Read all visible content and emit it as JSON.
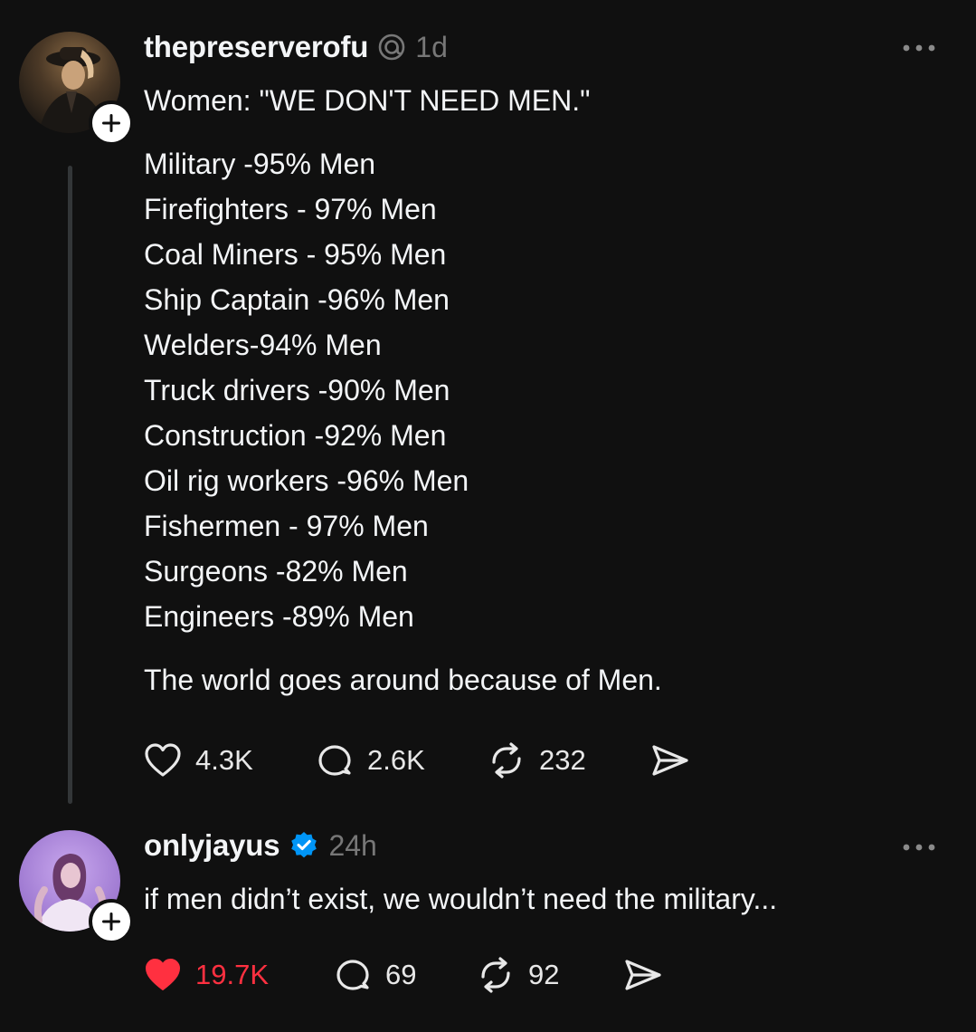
{
  "posts": [
    {
      "username": "thepreserverofu",
      "time": "1d",
      "lines": [
        "Women: \"WE DON'T NEED MEN.\"",
        "Military -95% Men",
        "Firefighters - 97% Men",
        "Coal Miners - 95% Men",
        "Ship Captain -96% Men",
        "Welders-94% Men",
        "Truck drivers -90% Men",
        "Construction -92% Men",
        "Oil rig workers -96% Men",
        "Fishermen - 97% Men",
        "Surgeons -82% Men",
        "Engineers -89% Men",
        "The world goes around because of Men."
      ],
      "likes": "4.3K",
      "replies": "2.6K",
      "reposts": "232",
      "liked": false,
      "icons": {
        "badge": "threads-icon",
        "like": "heart-icon",
        "reply": "comment-icon",
        "repost": "repost-icon",
        "share": "send-icon"
      }
    },
    {
      "username": "onlyjayus",
      "time": "24h",
      "verified": true,
      "lines": [
        "if men didn’t exist, we wouldn’t need the military..."
      ],
      "likes": "19.7K",
      "replies": "69",
      "reposts": "92",
      "liked": true,
      "icons": {
        "badge": "verified-icon",
        "like": "heart-filled-icon",
        "reply": "comment-icon",
        "repost": "repost-icon",
        "share": "send-icon"
      }
    }
  ],
  "colors": {
    "background": "#101010",
    "text": "#f3f5f7",
    "muted": "#777777",
    "liked": "#ff3040",
    "verified": "#0095f6"
  }
}
